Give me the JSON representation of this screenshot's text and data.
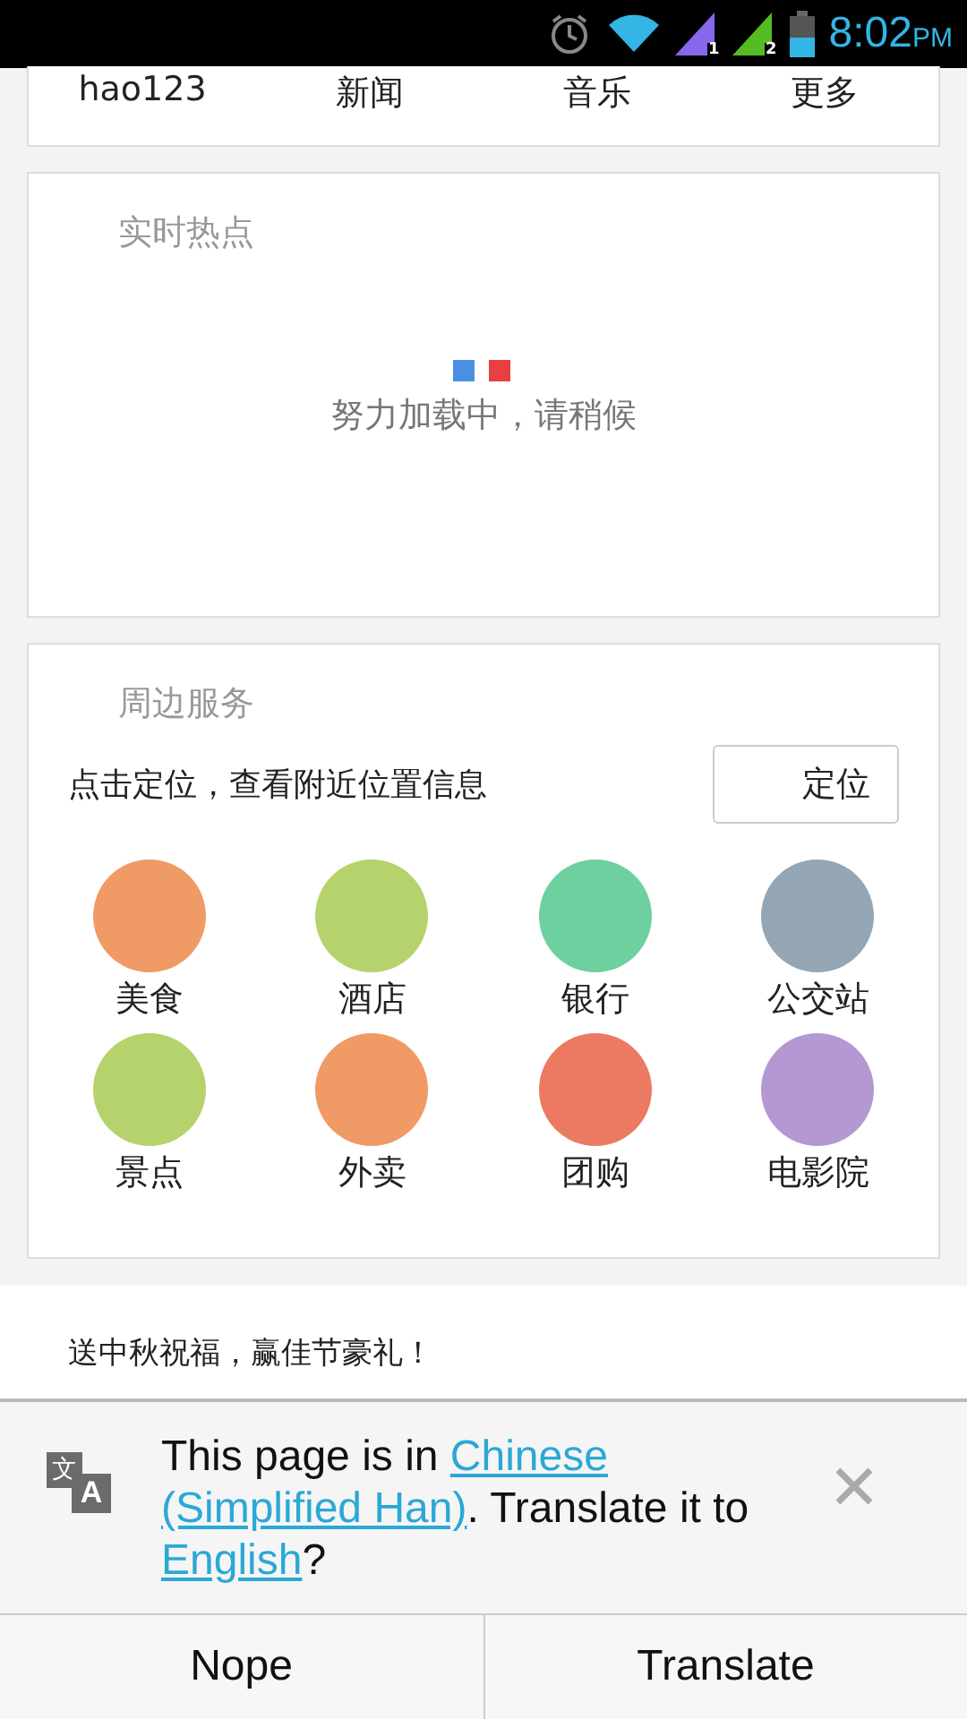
{
  "status_bar": {
    "sim_labels": [
      "1",
      "2"
    ],
    "time": "8:02",
    "ampm": "PM"
  },
  "nav": [
    "hao123",
    "新闻",
    "音乐",
    "更多"
  ],
  "hot": {
    "title": "实时热点",
    "loading": "努力加载中，请稍候"
  },
  "nearby": {
    "title": "周边服务",
    "hint": "点击定位，查看附近位置信息",
    "button": "定位",
    "services": [
      {
        "label": "美食",
        "color": "#f09a66"
      },
      {
        "label": "酒店",
        "color": "#b5d26c"
      },
      {
        "label": "银行",
        "color": "#6fd09f"
      },
      {
        "label": "公交站",
        "color": "#94a5b3"
      },
      {
        "label": "景点",
        "color": "#b5d26c"
      },
      {
        "label": "外卖",
        "color": "#f09a66"
      },
      {
        "label": "团购",
        "color": "#ec7a62"
      },
      {
        "label": "电影院",
        "color": "#b498d2"
      }
    ]
  },
  "promo": "送中秋祝福，赢佳节豪礼！",
  "translate_bar": {
    "icon_glyphs": [
      "文",
      "A"
    ],
    "message": [
      {
        "kind": "text",
        "text": "This page is in "
      },
      {
        "kind": "link",
        "text": "Chinese"
      },
      {
        "kind": "link",
        "text": "(Simplified Han)"
      },
      {
        "kind": "text",
        "text": ". Translate it to "
      },
      {
        "kind": "link",
        "text": "English"
      },
      {
        "kind": "text",
        "text": "?"
      }
    ],
    "buttons": [
      "Nope",
      "Translate"
    ]
  }
}
